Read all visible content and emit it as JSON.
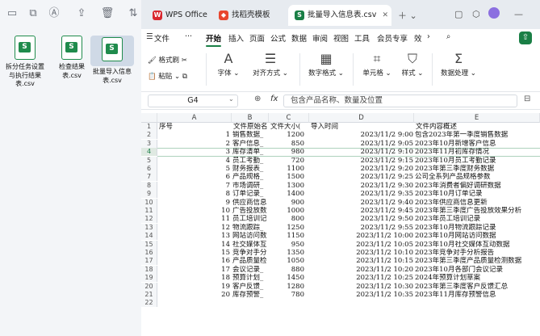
{
  "explorer": {
    "files": [
      {
        "name": "拆分任务设置与执行结果表.csv"
      },
      {
        "name": "检查结果表.csv"
      },
      {
        "name": "批量导入信息表.csv"
      }
    ]
  },
  "wps": {
    "tabs": [
      {
        "label": "WPS Office"
      },
      {
        "label": "找稻壳模板"
      },
      {
        "label": "批量导入信息表.csv"
      }
    ],
    "menu": [
      "文件",
      "开始",
      "插入",
      "页面",
      "公式",
      "数据",
      "审阅",
      "视图",
      "工具",
      "会员专享",
      "效"
    ],
    "menu_prefix": "☰",
    "ribbon": {
      "format_painter": "格式刷",
      "paste": "粘贴",
      "font": "字体",
      "alignment": "对齐方式",
      "number_format": "数字格式",
      "cell": "单元格",
      "style": "样式",
      "data_processing": "数据处理"
    },
    "name_box": "G4",
    "formula_placeholder": "包含产品名称、数量及位置",
    "fx_label": "fx",
    "columns": [
      "A",
      "B",
      "C",
      "D",
      "E"
    ],
    "header_row": [
      "序号",
      "文件原始名",
      "文件大小(",
      "导入时间",
      "文件内容概述"
    ],
    "rows": [
      [
        "1",
        "销售数据_",
        "1200",
        "2023/11/2  9:00",
        "包含2023年第一季度销售数据"
      ],
      [
        "2",
        "客户信息_",
        "850",
        "2023/11/2  9:05",
        "2023年10月新增客户信息"
      ],
      [
        "3",
        "库存清单_",
        "980",
        "2023/11/2  9:10",
        "2023年11月初库存情况"
      ],
      [
        "4",
        "员工考勤_",
        "720",
        "2023/11/2  9:15",
        "2023年10月员工考勤记录"
      ],
      [
        "5",
        "财务报表_",
        "1100",
        "2023/11/2  9:20",
        "2023年第三季度财务数据"
      ],
      [
        "6",
        "产品规格_",
        "1500",
        "2023/11/2  9:25",
        "公司全系列产品规格参数"
      ],
      [
        "7",
        "市场调研_",
        "1300",
        "2023/11/2  9:30",
        "2023年消费者偏好调研数据"
      ],
      [
        "8",
        "订单记录_",
        "1400",
        "2023/11/2  9:35",
        "2023年10月订单记录"
      ],
      [
        "9",
        "供应商信息",
        "900",
        "2023/11/2  9:40",
        "2023年供应商信息更新"
      ],
      [
        "10",
        "广告投放数",
        "1000",
        "2023/11/2  9:45",
        "2023年第三季度广告投放效果分析"
      ],
      [
        "11",
        "员工培训记",
        "800",
        "2023/11/2  9:50",
        "2023年员工培训记录"
      ],
      [
        "12",
        "物流跟踪_",
        "1250",
        "2023/11/2  9:55",
        "2023年10月物流跟踪记录"
      ],
      [
        "13",
        "网站访问数",
        "1150",
        "2023/11/2  10:00",
        "2023年10月网站访问数据"
      ],
      [
        "14",
        "社交媒体互",
        "950",
        "2023/11/2  10:05",
        "2023年10月社交媒体互动数据"
      ],
      [
        "15",
        "竞争对手分",
        "1350",
        "2023/11/2  10:10",
        "2023年竞争对手分析报告"
      ],
      [
        "16",
        "产品质量检",
        "1050",
        "2023/11/2  10:15",
        "2023年第三季度产品质量检测数据"
      ],
      [
        "17",
        "会议记录_",
        "880",
        "2023/11/2  10:20",
        "2023年10月各部门会议记录"
      ],
      [
        "18",
        "预算计划_",
        "1450",
        "2023/11/2  10:25",
        "2024年预算计划草案"
      ],
      [
        "19",
        "客户反馈_",
        "1280",
        "2023/11/2  10:30",
        "2023年第三季度客户反馈汇总"
      ],
      [
        "20",
        "库存预警_",
        "780",
        "2023/11/2  10:35",
        "2023年11月库存预警信息"
      ]
    ],
    "selected_row": 4,
    "accent_color": "#1a7f46"
  }
}
